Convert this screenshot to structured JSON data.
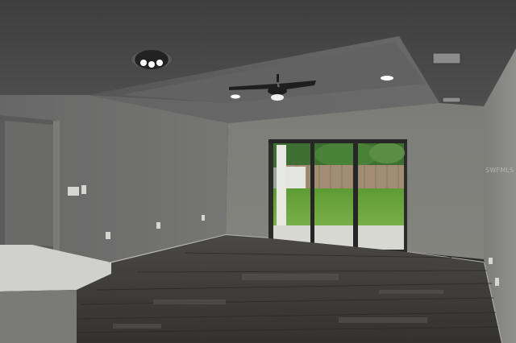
{
  "watermark": {
    "text": "SWFMLS"
  },
  "colors": {
    "ceiling": "#474747",
    "tray": "#5b5b5b",
    "wall_left": "#6f6f6f",
    "wall_back": "#7a7a77",
    "wall_right": "#858582",
    "floor": "#3f3d3b",
    "grass": "#6fa03f",
    "fence": "#a28d74",
    "frame": "#2e2e2e"
  },
  "icons": [
    "ceiling-light-icon",
    "ceiling-fan-icon",
    "air-vent-icon",
    "light-switch-icon",
    "outlet-icon"
  ]
}
